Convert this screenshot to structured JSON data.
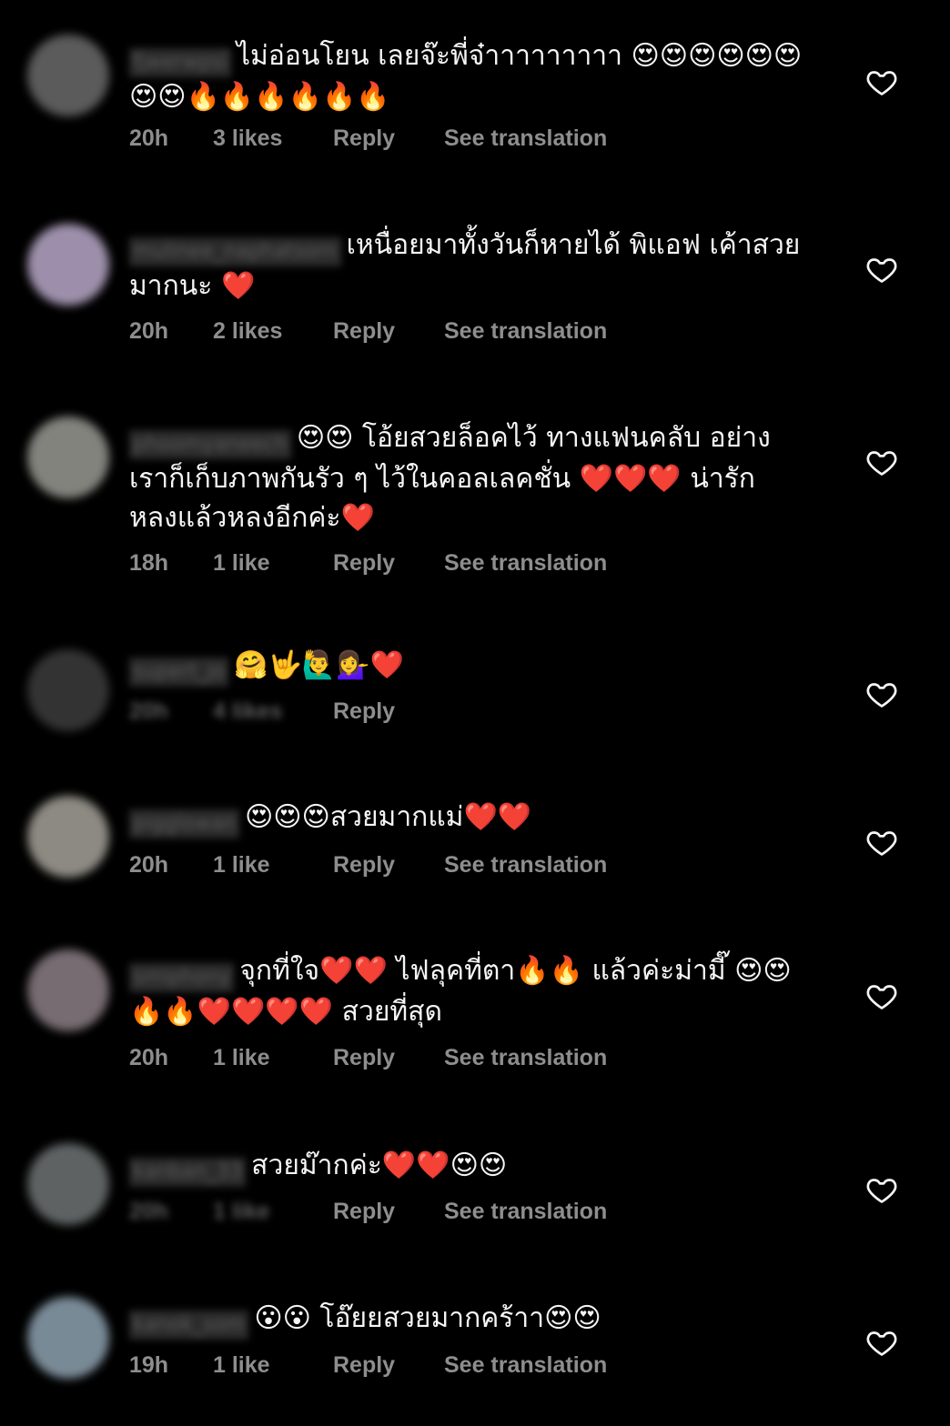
{
  "comments": [
    {
      "username": "fjwerwpsi",
      "text": "ไม่อ่อนโยน เลยจ๊ะพี่จ๋าาาาาาาาา 😍😍😍😍😍😍😍😍🔥🔥🔥🔥🔥🔥",
      "time": "20h",
      "likes": "3 likes",
      "reply": "Reply",
      "translate": "See translation",
      "avatar_color": "#6b6b6b"
    },
    {
      "username": "mulinee_naphatsorn",
      "text": "เหนื่อยมาทั้งวันก็หายได้ พิแอฟ เค้าสวยมากนะ ❤️",
      "time": "20h",
      "likes": "2 likes",
      "reply": "Reply",
      "translate": "See translation",
      "avatar_color": "#b9a9c9"
    },
    {
      "username": "phoomyaneech",
      "text": "😍😍 โอ้ยสวยล็อคไว้ ทางแฟนคลับ อย่างเราก็เก็บภาพกันรัว ๆ ไว้ในคอลเลคชั่น ❤️❤️❤️ น่ารักหลงแล้วหลงอีกค่ะ❤️",
      "time": "18h",
      "likes": "1 like",
      "reply": "Reply",
      "translate": "See translation",
      "avatar_color": "#9a9a94"
    },
    {
      "username": "supert_jo",
      "text": "🤗🤟🙋‍♂️💁‍♀️❤️",
      "time": "20h",
      "likes": "4 likes",
      "reply": "Reply",
      "translate": "",
      "avatar_color": "#3d3d3d"
    },
    {
      "username": "pigglowan",
      "text": "😍😍😍สวยมากแม่❤️❤️",
      "time": "20h",
      "likes": "1 like",
      "reply": "Reply",
      "translate": "See translation",
      "avatar_color": "#a6a39a"
    },
    {
      "username": "smiphony",
      "text": "จุกที่ใจ❤️❤️ ไฟลุคที่ตา🔥🔥 แล้วค่ะม่ามี๊ 😍😍🔥🔥❤️❤️❤️❤️ สวยที่สุด",
      "time": "20h",
      "likes": "1 like",
      "reply": "Reply",
      "translate": "See translation",
      "avatar_color": "#8c7f86"
    },
    {
      "username": "kanban_33",
      "text": "สวยม๊ากค่ะ❤️❤️😍😍",
      "time": "20h",
      "likes": "1 like",
      "reply": "Reply",
      "translate": "See translation",
      "avatar_color": "#6f7474"
    },
    {
      "username": "kanok_som",
      "text": "😮😮 โอ๊ยยสวยมากคร้าา😍😍",
      "time": "19h",
      "likes": "1 like",
      "reply": "Reply",
      "translate": "See translation",
      "avatar_color": "#8fa3b2"
    }
  ],
  "icons": {
    "like": "heart-outline-icon"
  },
  "colors": {
    "background": "#000000",
    "text": "#f5f5f5",
    "meta": "#8e8e8e"
  }
}
